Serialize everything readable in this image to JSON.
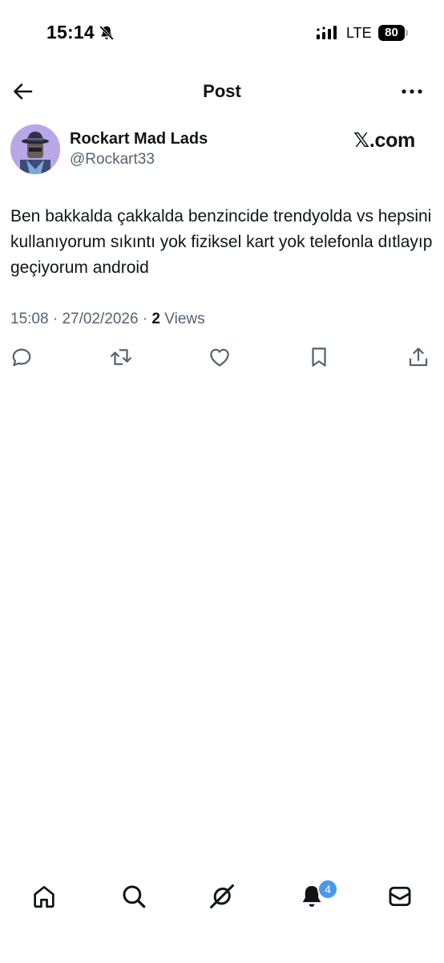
{
  "status_bar": {
    "time": "15:14",
    "network": "LTE",
    "battery": "80",
    "icons": [
      "bell-off-icon",
      "signal-icon",
      "battery-icon"
    ]
  },
  "header": {
    "title": "Post",
    "icons": [
      "back-arrow-icon",
      "more-icon"
    ]
  },
  "author": {
    "name": "Rockart Mad Lads",
    "handle": "@Rockart33",
    "avatar_bg": "#b9a6e8"
  },
  "brand": {
    "watermark": "𝕏.com"
  },
  "tweet": {
    "text": "Ben bakkalda çakkalda benzincide trendyolda vs hepsini kullanıyorum sıkıntı yok fiziksel kart yok telefonla dıtlayıp geçiyorum android",
    "time": "15:08",
    "separator": " · ",
    "date": "27/02/2026",
    "views_count": "2",
    "views_label": "Views"
  },
  "actions": [
    "reply-icon",
    "repost-icon",
    "like-icon",
    "bookmark-icon",
    "share-icon"
  ],
  "bottom_nav": {
    "items": [
      "home-icon",
      "search-icon",
      "grok-icon",
      "notifications-icon",
      "messages-icon"
    ],
    "notification_count": "4",
    "badge_color": "#4a99e9"
  },
  "colors": {
    "text_primary": "#0f1419",
    "text_secondary": "#536471"
  }
}
